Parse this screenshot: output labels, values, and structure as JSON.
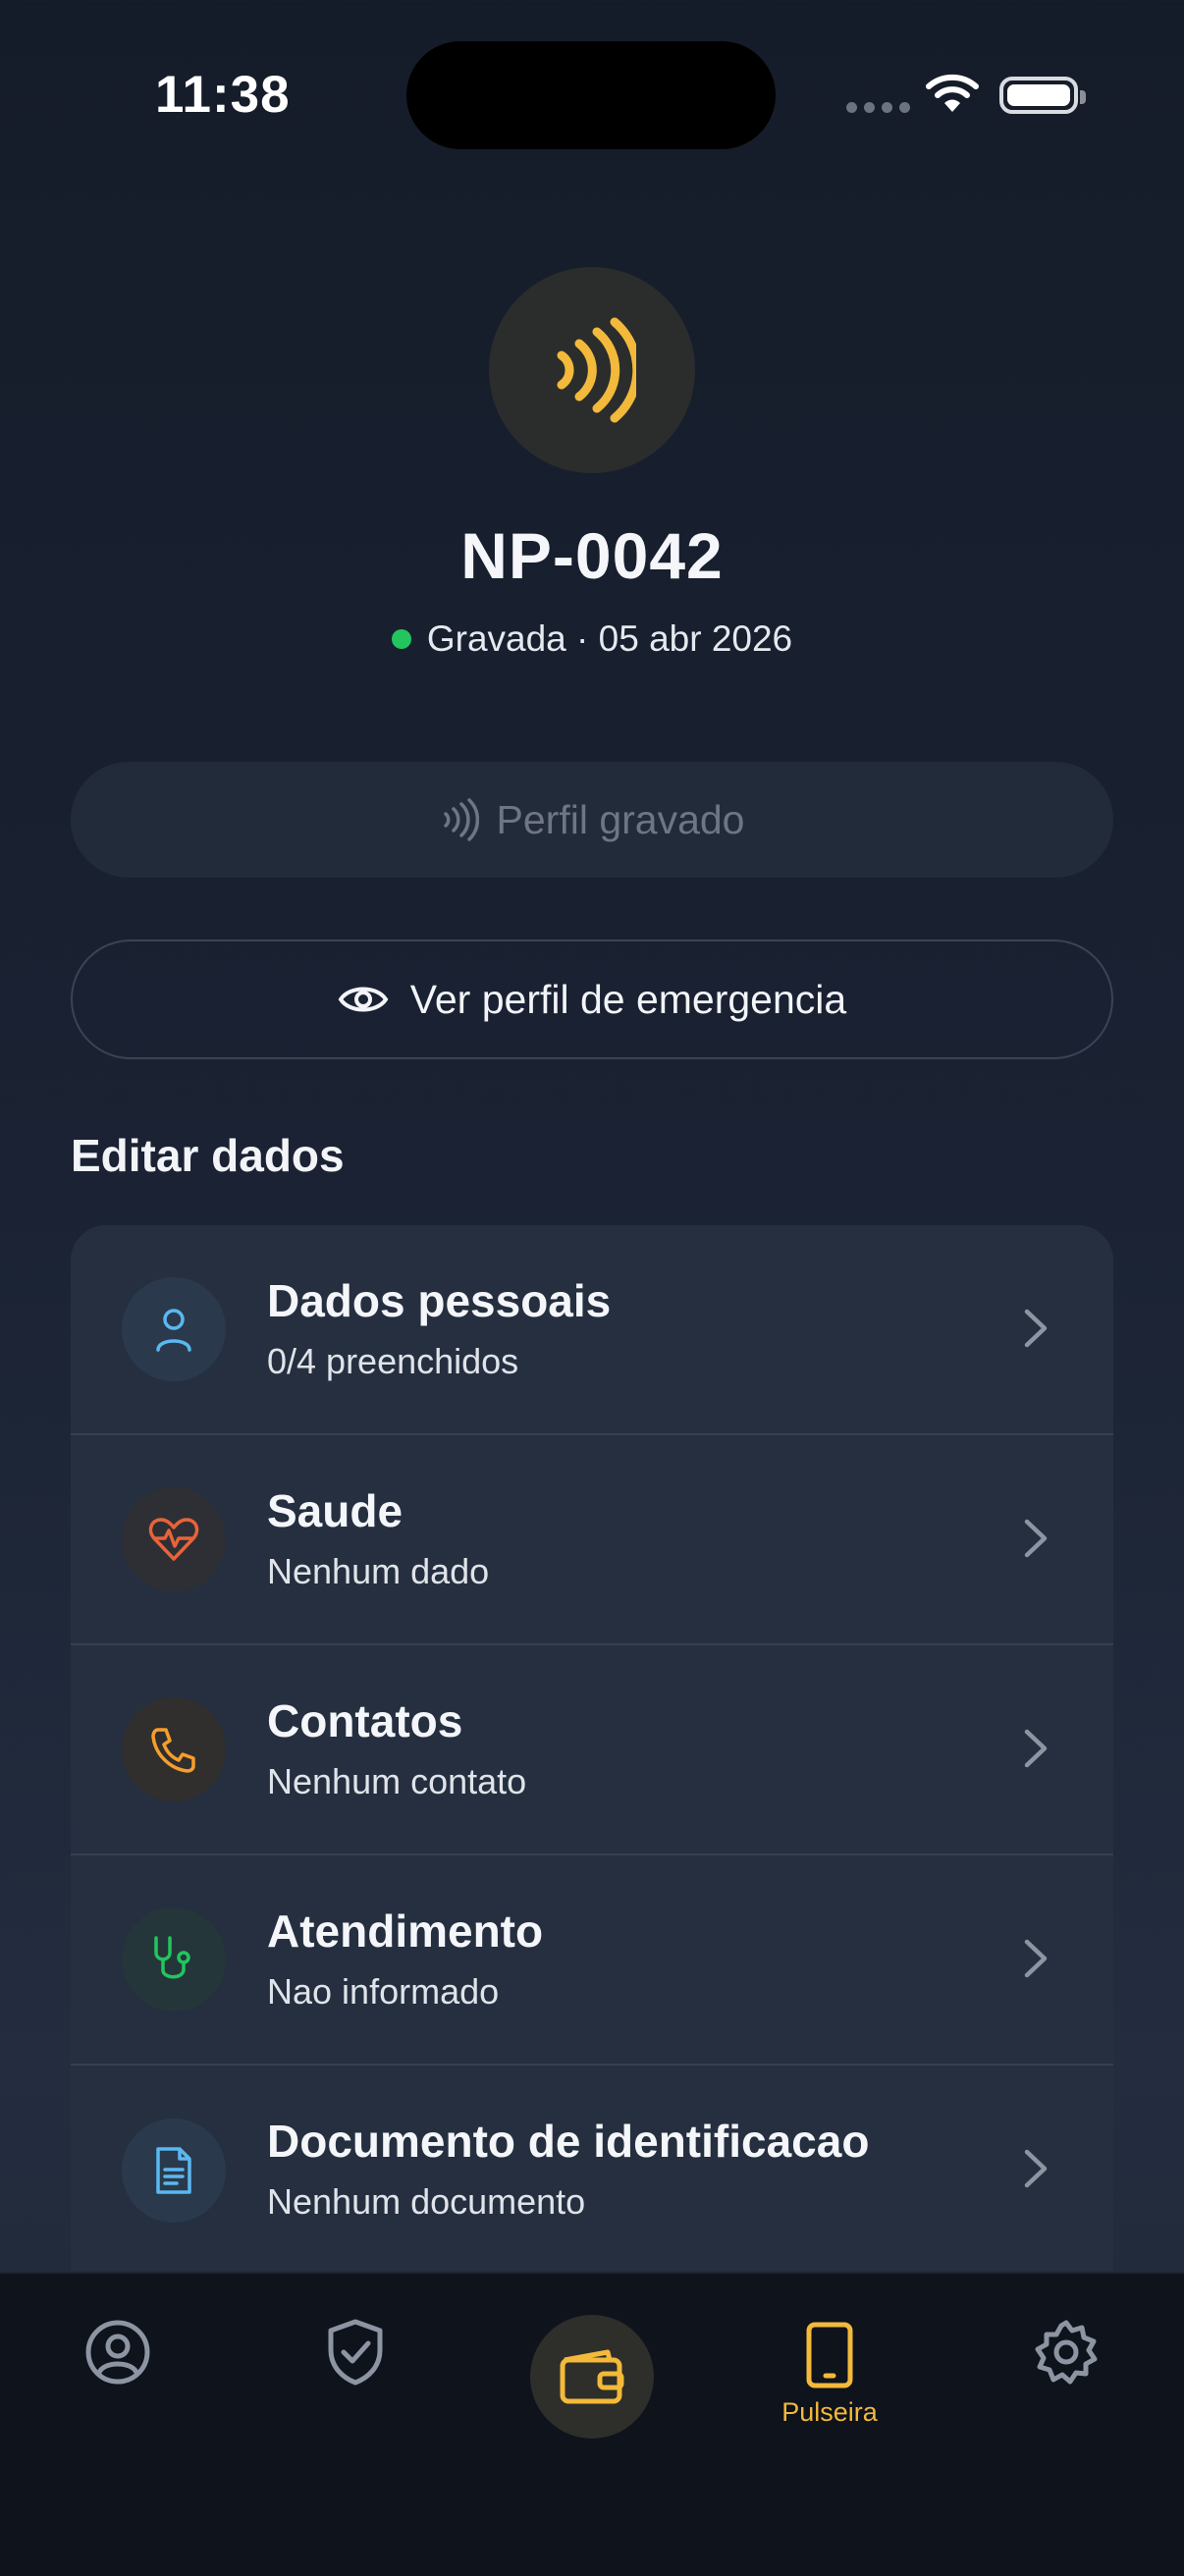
{
  "status_bar": {
    "time": "11:38"
  },
  "tag": {
    "id": "NP-0042",
    "status_text": "Gravada · 05 abr 2026",
    "status_color": "#22c55e",
    "icon": "nfc-waves-icon",
    "accent_color": "#f3b93a"
  },
  "actions": {
    "primary_label": "Perfil gravado",
    "secondary_label": "Ver perfil de emergencia"
  },
  "section": {
    "title": "Editar dados"
  },
  "items": [
    {
      "title": "Dados pessoais",
      "subtitle": "0/4 preenchidos",
      "icon": "person-icon",
      "color": "#5bb8f0"
    },
    {
      "title": "Saude",
      "subtitle": "Nenhum dado",
      "icon": "heart-pulse-icon",
      "color": "#e8633a"
    },
    {
      "title": "Contatos",
      "subtitle": "Nenhum contato",
      "icon": "phone-icon",
      "color": "#f59e2b"
    },
    {
      "title": "Atendimento",
      "subtitle": "Nao informado",
      "icon": "stethoscope-icon",
      "color": "#22c55e"
    },
    {
      "title": "Documento de identificacao",
      "subtitle": "Nenhum documento",
      "icon": "document-icon",
      "color": "#5bb8f0"
    }
  ],
  "tabbar": {
    "tabs": [
      {
        "icon": "user-circle-icon"
      },
      {
        "icon": "shield-check-icon"
      },
      {
        "icon": "wallet-icon"
      },
      {
        "icon": "phone-device-icon",
        "label": "Pulseira",
        "active": true
      },
      {
        "icon": "gear-icon"
      }
    ]
  }
}
